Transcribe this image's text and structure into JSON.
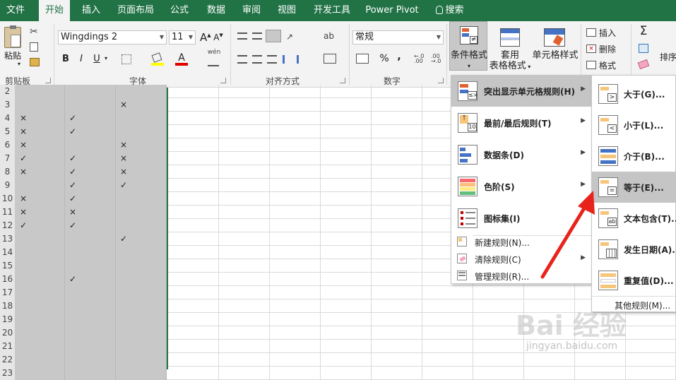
{
  "tabs": [
    "文件",
    "开始",
    "插入",
    "页面布局",
    "公式",
    "数据",
    "审阅",
    "视图",
    "开发工具",
    "Power Pivot",
    "搜索"
  ],
  "ribbon": {
    "clipboard": {
      "paste": "粘贴",
      "label": "剪贴板"
    },
    "font": {
      "name": "Wingdings 2",
      "size": "11",
      "label": "字体",
      "bold": "B",
      "italic": "I",
      "underline": "U",
      "grow": "A",
      "shrink": "A",
      "phonetic": "wén",
      "font_color_glyph": "A"
    },
    "alignment": {
      "label": "对齐方式"
    },
    "number": {
      "format": "常规",
      "label": "数字",
      "percent": "%",
      "comma": ","
    },
    "styles": {
      "conditional": "条件格式",
      "table_line1": "套用",
      "table_line2": "表格格式",
      "cell": "单元格样式"
    },
    "cells": {
      "insert": "插入",
      "delete": "删除",
      "format": "格式"
    },
    "editing": {
      "sum": "Σ",
      "sort": "排序"
    }
  },
  "rows": [
    {
      "num": "2",
      "a": "",
      "b": "",
      "c": ""
    },
    {
      "num": "3",
      "a": "",
      "b": "",
      "c": "×"
    },
    {
      "num": "4",
      "a": "×",
      "b": "✓",
      "c": ""
    },
    {
      "num": "5",
      "a": "×",
      "b": "✓",
      "c": ""
    },
    {
      "num": "6",
      "a": "×",
      "b": "",
      "c": "×"
    },
    {
      "num": "7",
      "a": "✓",
      "b": "✓",
      "c": "×"
    },
    {
      "num": "8",
      "a": "×",
      "b": "✓",
      "c": "×"
    },
    {
      "num": "9",
      "a": "",
      "b": "✓",
      "c": "✓"
    },
    {
      "num": "10",
      "a": "×",
      "b": "✓",
      "c": ""
    },
    {
      "num": "11",
      "a": "×",
      "b": "×",
      "c": ""
    },
    {
      "num": "12",
      "a": "✓",
      "b": "✓",
      "c": ""
    },
    {
      "num": "13",
      "a": "",
      "b": "",
      "c": "✓"
    },
    {
      "num": "14",
      "a": "",
      "b": "",
      "c": ""
    },
    {
      "num": "15",
      "a": "",
      "b": "",
      "c": ""
    },
    {
      "num": "16",
      "a": "",
      "b": "✓",
      "c": ""
    },
    {
      "num": "17",
      "a": "",
      "b": "",
      "c": ""
    },
    {
      "num": "18",
      "a": "",
      "b": "",
      "c": ""
    },
    {
      "num": "19",
      "a": "",
      "b": "",
      "c": ""
    },
    {
      "num": "20",
      "a": "",
      "b": "",
      "c": ""
    },
    {
      "num": "21",
      "a": "",
      "b": "",
      "c": ""
    },
    {
      "num": "22",
      "a": "",
      "b": "",
      "c": ""
    },
    {
      "num": "23",
      "a": "",
      "b": "",
      "c": ""
    }
  ],
  "menu": {
    "highlight": "突出显示单元格规则(H)",
    "topbottom": "最前/最后规则(T)",
    "databar": "数据条(D)",
    "colorscale": "色阶(S)",
    "iconset": "图标集(I)",
    "newrule": "新建规则(N)...",
    "clearrule": "清除规则(C)",
    "managerule": "管理规则(R)..."
  },
  "submenu": {
    "greater": "大于(G)...",
    "less": "小于(L)...",
    "between": "介于(B)...",
    "equal": "等于(E)...",
    "contains": "文本包含(T)...",
    "date": "发生日期(A)...",
    "duplicate": "重复值(D)...",
    "more": "其他规则(M)..."
  },
  "watermark": {
    "line1": "Bai 经验",
    "line2": "jingyan.baidu.com"
  },
  "colors": {
    "accent": "#217346",
    "arrow": "#e8231c"
  }
}
